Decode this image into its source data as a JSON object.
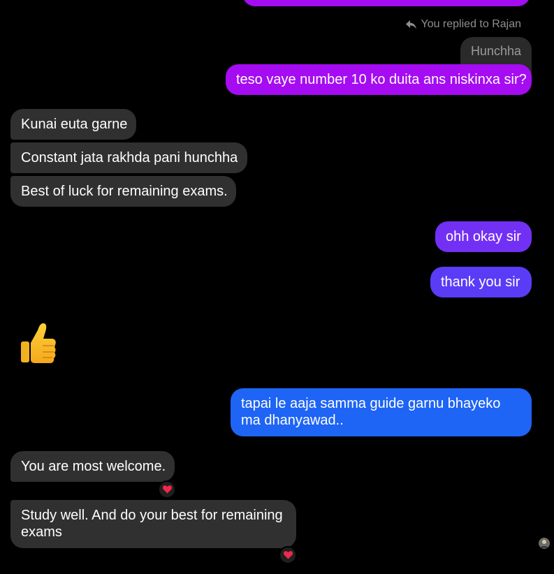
{
  "reply_context": {
    "text": "You replied to Rajan",
    "quoted_text": "Hunchha"
  },
  "messages": [
    {
      "id": "m1",
      "direction": "outgoing",
      "text": "teso vaye number 10 ko duita ans niskinxa sir?",
      "color": "#a50cf2"
    },
    {
      "id": "m2",
      "direction": "incoming",
      "text": "Kunai euta garne"
    },
    {
      "id": "m3",
      "direction": "incoming",
      "text": "Constant jata rakhda pani hunchha"
    },
    {
      "id": "m4",
      "direction": "incoming",
      "text": "Best of luck for remaining exams."
    },
    {
      "id": "m5",
      "direction": "outgoing",
      "text": "ohh okay sir",
      "color": "#7330f5"
    },
    {
      "id": "m6",
      "direction": "outgoing",
      "text": "thank you sir",
      "color": "#5a3cf7"
    },
    {
      "id": "m7",
      "direction": "incoming",
      "type": "emoji",
      "emoji": "thumbs-up-icon"
    },
    {
      "id": "m8",
      "direction": "outgoing",
      "text": "tapai le aaja samma guide garnu bhayeko ma dhanyawad..",
      "color": "#1e64f5"
    },
    {
      "id": "m9",
      "direction": "incoming",
      "text": "You are most welcome.",
      "reaction": "heart-icon"
    },
    {
      "id": "m10",
      "direction": "incoming",
      "text": "Study well. And do your best for remaining exams",
      "reaction": "heart-icon"
    }
  ],
  "theme": {
    "background": "#000000",
    "incoming_bubble": "#303030",
    "reaction_color": "#f0284a"
  }
}
